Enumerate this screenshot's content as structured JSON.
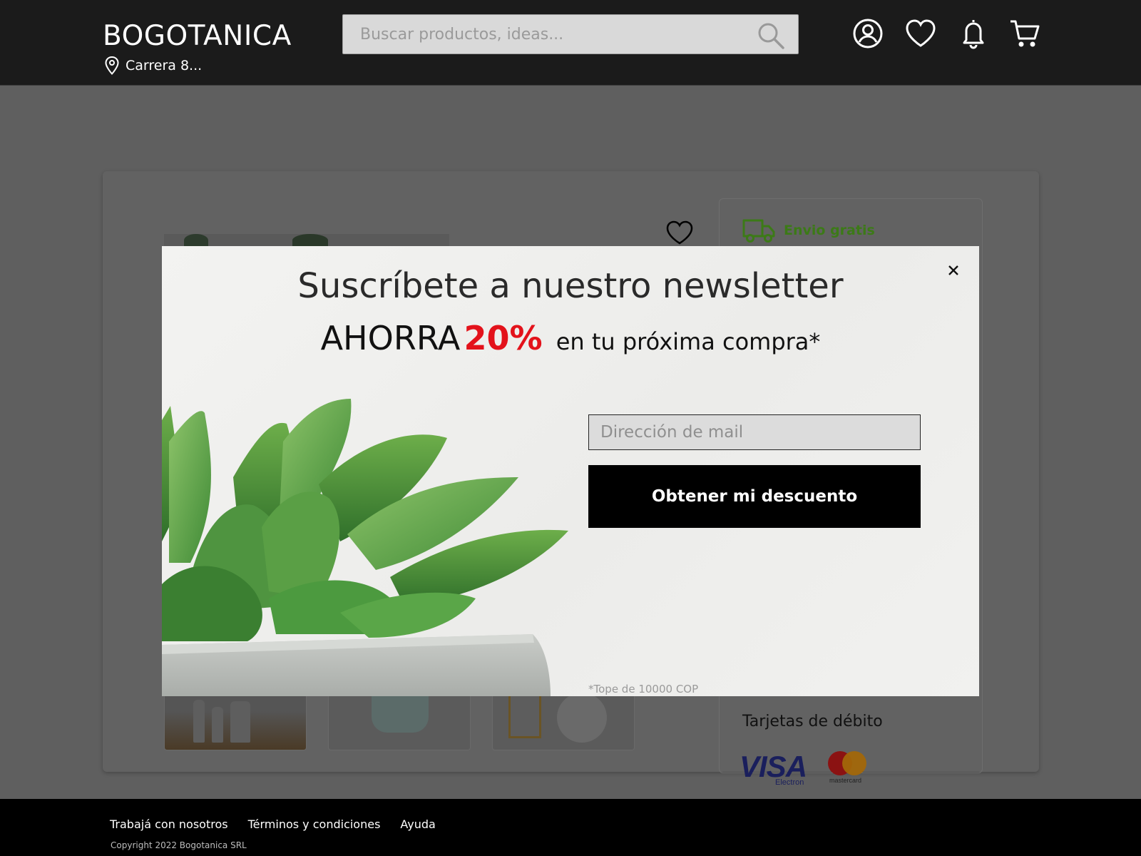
{
  "header": {
    "logo": "BOGOTANICA",
    "location": "Carrera 8...",
    "search_placeholder": "Buscar productos, ideas...",
    "icons": [
      "user-icon",
      "heart-icon",
      "bell-icon",
      "cart-icon"
    ]
  },
  "product": {
    "shipping_label": "Envio gratis",
    "debit_label": "Tarjetas de débito",
    "visa_text": "VISA",
    "visa_sub": "Electron",
    "mastercard_text": "mastercard"
  },
  "modal": {
    "title": "Suscríbete a nuestro newsletter",
    "save_word": "AHORRA",
    "discount": "20%",
    "discount_rest": "en tu próxima compra*",
    "email_placeholder": "Dirección de mail",
    "cta_label": "Obtener mi descuento",
    "note": "*Tope de 10000 COP"
  },
  "footer": {
    "links": [
      "Trabajá con nosotros",
      "Términos y condiciones",
      "Ayuda"
    ],
    "copyright": "Copyright 2022 Bogotanica SRL"
  },
  "colors": {
    "header_bg": "#1b1b1b",
    "overlay": "#5f5f5f",
    "discount_red": "#e3121b",
    "shipping_green": "#3c7a17",
    "cta_bg": "#000000"
  }
}
